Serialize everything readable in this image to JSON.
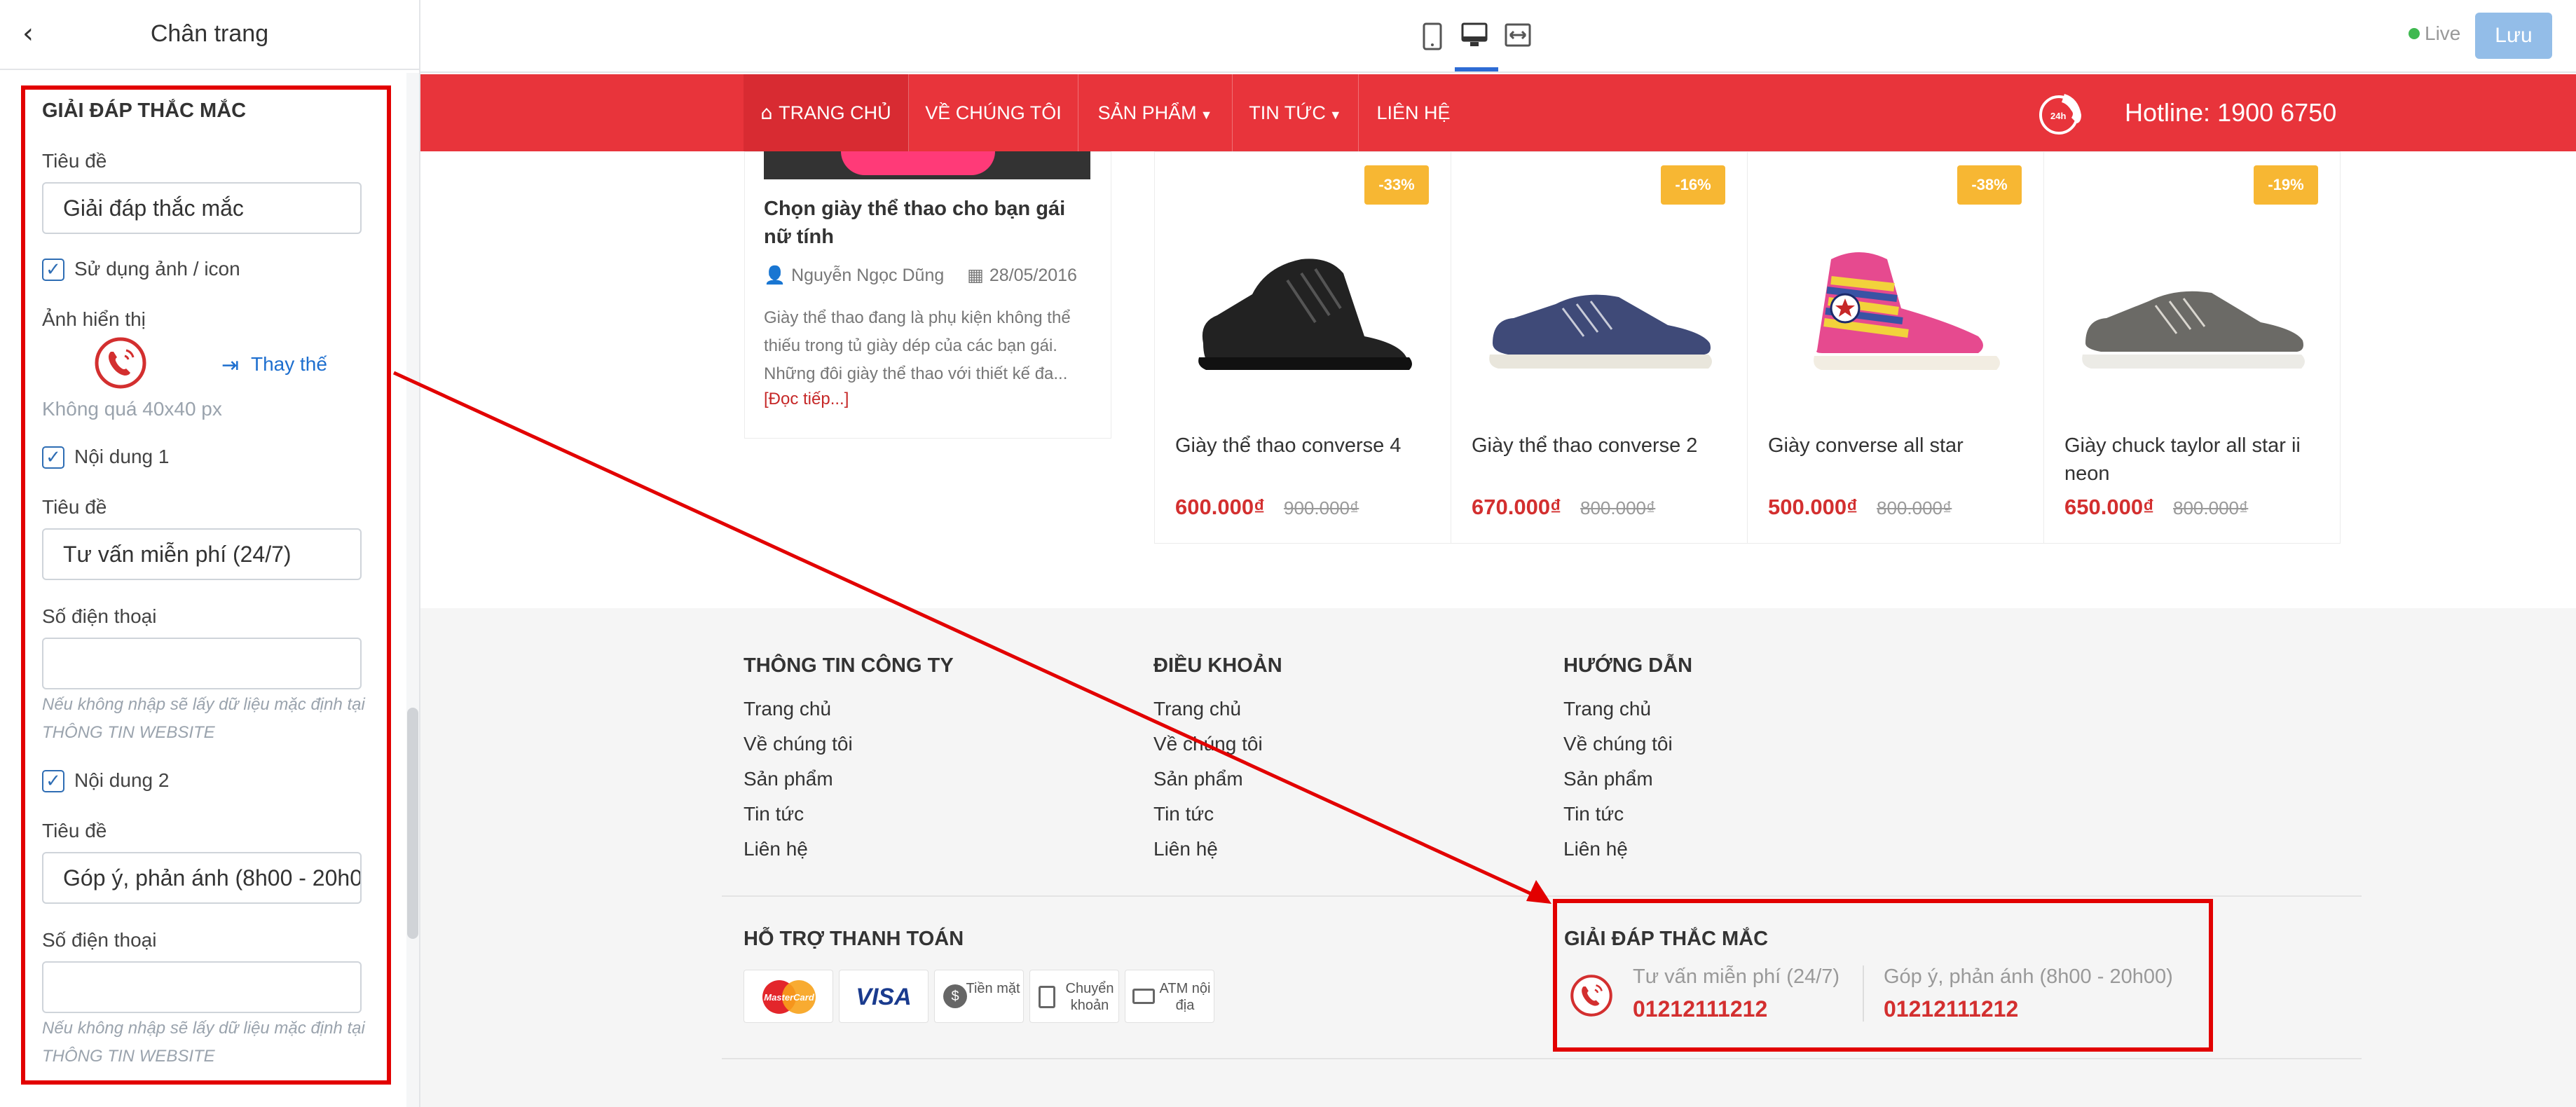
{
  "left_panel": {
    "title": "Chân trang",
    "section_title": "GIẢI ĐÁP THẮC MẮC",
    "title_label": "Tiêu đề",
    "title_value": "Giải đáp thắc mắc",
    "use_icon_label": "Sử dụng ảnh / icon",
    "image_label": "Ảnh hiển thị",
    "replace_label": "Thay thế",
    "size_hint": "Không quá 40x40 px",
    "content1": {
      "check_label": "Nội dung 1",
      "title_label": "Tiêu đề",
      "title_value": "Tư vấn miễn phí (24/7)",
      "phone_label": "Số điện thoại",
      "phone_value": "",
      "hint_line1": "Nếu không nhập sẽ lấy dữ liệu mặc định tại",
      "hint_line2": "THÔNG TIN WEBSITE"
    },
    "content2": {
      "check_label": "Nội dung 2",
      "title_label": "Tiêu đề",
      "title_value": "Góp ý, phản ánh (8h00 - 20h00)",
      "phone_label": "Số điện thoại",
      "phone_value": "",
      "hint_line1": "Nếu không nhập sẽ lấy dữ liệu mặc định tại",
      "hint_line2": "THÔNG TIN WEBSITE"
    }
  },
  "topbar": {
    "live_label": "Live",
    "save_label": "Lưu",
    "accent_color": "#2d6bd4"
  },
  "nav": {
    "items": [
      "TRANG CHỦ",
      "VỀ CHÚNG TÔI",
      "SẢN PHẨM",
      "TIN TỨC",
      "LIÊN HỆ"
    ],
    "hotline": "Hotline: 1900 6750",
    "bg_color": "#e8343b"
  },
  "article": {
    "title": "Chọn giày thể thao cho bạn gái nữ tính",
    "author": "Nguyễn Ngọc Dũng",
    "date": "28/05/2016",
    "body_line1": "Giày thể thao đang là phụ kiện không thể",
    "body_line2": "thiếu trong tủ giày dép của các bạn gái.",
    "body_line3": "Những đôi giày thể thao với thiết kế đa...",
    "more": "[Đọc tiếp...]"
  },
  "products": [
    {
      "badge": "-33%",
      "name": "Giày thể thao converse 4",
      "price": "600.000₫",
      "old_price": "900.000₫"
    },
    {
      "badge": "-16%",
      "name": "Giày thể thao converse 2",
      "price": "670.000₫",
      "old_price": "800.000₫"
    },
    {
      "badge": "-38%",
      "name": "Giày converse all star",
      "price": "500.000₫",
      "old_price": "800.000₫"
    },
    {
      "badge": "-19%",
      "name": "Giày chuck taylor all star ii neon",
      "price": "650.000₫",
      "old_price": "800.000₫"
    }
  ],
  "footer": {
    "columns": [
      {
        "heading": "THÔNG TIN CÔNG TY",
        "links": [
          "Trang chủ",
          "Về chúng tôi",
          "Sản phẩm",
          "Tin tức",
          "Liên hệ"
        ]
      },
      {
        "heading": "ĐIỀU KHOẢN",
        "links": [
          "Trang chủ",
          "Về chúng tôi",
          "Sản phẩm",
          "Tin tức",
          "Liên hệ"
        ]
      },
      {
        "heading": "HƯỚNG DẪN",
        "links": [
          "Trang chủ",
          "Về chúng tôi",
          "Sản phẩm",
          "Tin tức",
          "Liên hệ"
        ]
      }
    ],
    "payment": {
      "heading": "HỖ TRỢ THANH TOÁN",
      "methods": [
        "MasterCard",
        "VISA",
        "Tiền mặt",
        "Chuyển khoản",
        "ATM nội địa"
      ]
    },
    "faq": {
      "heading": "GIẢI ĐÁP THẮC MẮC",
      "item1_title": "Tư vấn miễn phí (24/7)",
      "item1_phone": "01212111212",
      "item2_title": "Góp ý, phản ánh (8h00 - 20h00)",
      "item2_phone": "01212111212"
    }
  },
  "annotation_color": "#e20000"
}
